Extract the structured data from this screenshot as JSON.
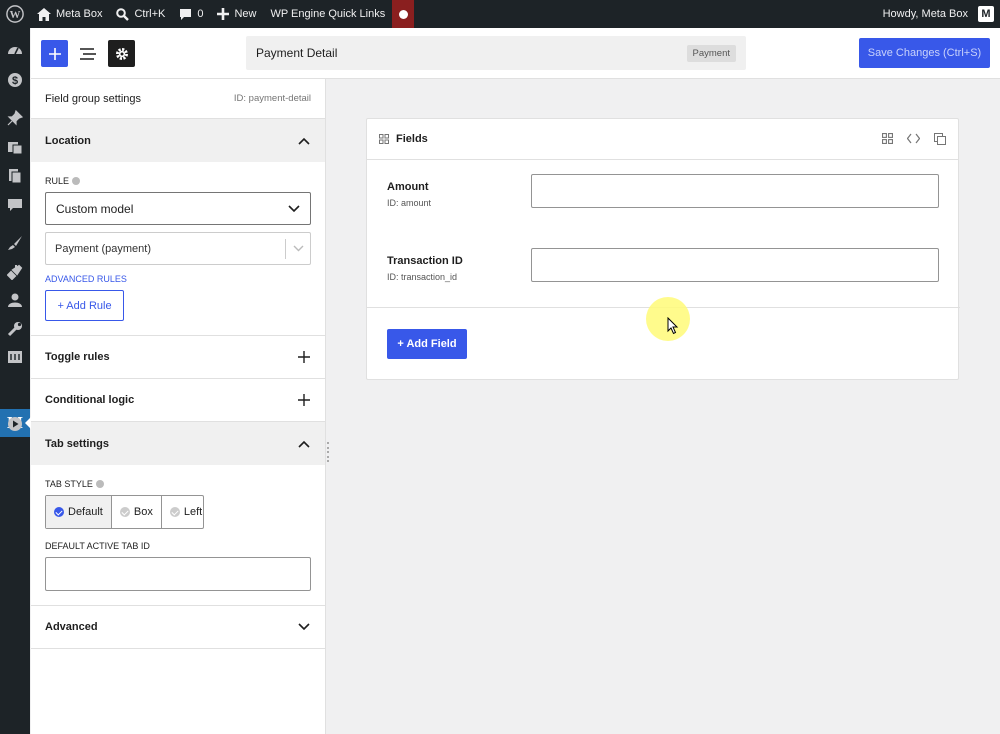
{
  "admin_bar": {
    "site_name": "Meta Box",
    "search_shortcut": "Ctrl+K",
    "comments_count": "0",
    "new_label": "New",
    "quick_links": "WP Engine Quick Links",
    "howdy": "Howdy, Meta Box",
    "avatar_letter": "M"
  },
  "admin_menu": {
    "active_letter": "M",
    "icons": [
      "dashboard-icon",
      "dollar-icon",
      "pin-icon",
      "media-icon",
      "pages-icon",
      "comments-icon",
      "brush-icon",
      "plugin-icon",
      "users-icon",
      "tools-icon",
      "settings-icon",
      "meta-box-icon",
      "play-icon"
    ]
  },
  "header": {
    "title": "Payment Detail",
    "badge": "Payment",
    "save_label": "Save Changes (Ctrl+S)"
  },
  "panel": {
    "title": "Field group settings",
    "id_label": "ID: payment-detail",
    "location": {
      "title": "Location",
      "rule_label": "RULE",
      "rule_value": "Custom model",
      "model_value": "Payment (payment)",
      "advanced_rules_label": "ADVANCED RULES",
      "add_rule_label": "+ Add Rule"
    },
    "toggle_rules": "Toggle rules",
    "conditional_logic": "Conditional logic",
    "tab_settings": {
      "title": "Tab settings",
      "tab_style_label": "TAB STYLE",
      "options": [
        "Default",
        "Box",
        "Left"
      ],
      "selected": "Default",
      "default_active_label": "DEFAULT ACTIVE TAB ID",
      "default_active_value": ""
    },
    "advanced": "Advanced"
  },
  "fields_card": {
    "title": "Fields",
    "fields": [
      {
        "label": "Amount",
        "id_text": "ID: amount",
        "value": ""
      },
      {
        "label": "Transaction ID",
        "id_text": "ID: transaction_id",
        "value": ""
      }
    ],
    "add_field_label": "+ Add Field"
  },
  "colors": {
    "accent": "#3858e9",
    "admin_bar": "#1d2327",
    "highlight": "#fffa78"
  }
}
